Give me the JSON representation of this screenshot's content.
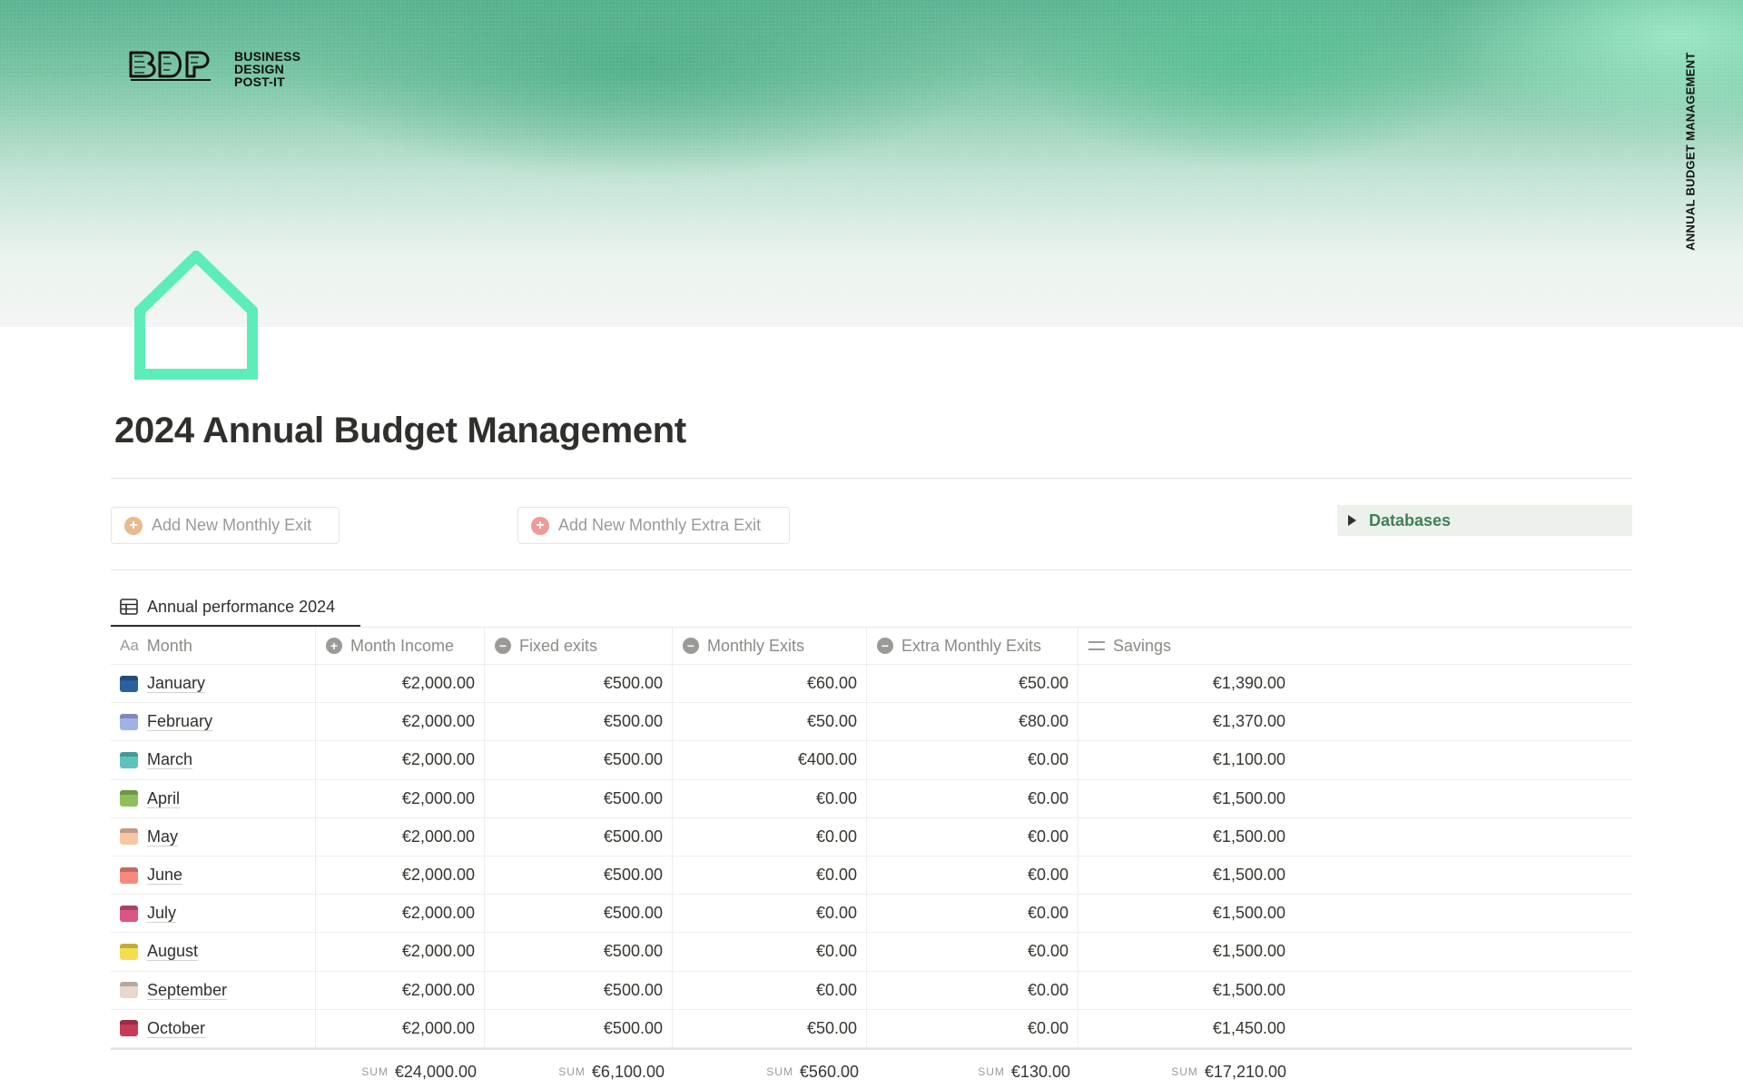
{
  "brand": {
    "logo_mark": "BDP",
    "logo_lines": [
      "BUSINESS",
      "DESIGN",
      "POST-IT"
    ],
    "vertical_label": "ANNUAL BUDGET MANAGEMENT"
  },
  "page": {
    "icon": "house-outline-icon",
    "title": "2024 Annual Budget Management"
  },
  "actions": {
    "add_monthly_exit": "Add New Monthly Exit",
    "add_monthly_extra_exit": "Add New Monthly Extra Exit",
    "databases_toggle": "Databases"
  },
  "colors": {
    "icon_accent": "#5cedb8",
    "plus_exit": "#e9b98f",
    "plus_extra_exit": "#ec9a9a",
    "databases_text": "#3f7f59"
  },
  "view": {
    "tab_label": "Annual performance 2024"
  },
  "table": {
    "headers": {
      "month": "Month",
      "month_prefix": "Aa",
      "income": "Month Income",
      "fixed": "Fixed exits",
      "monthly": "Monthly Exits",
      "extra": "Extra Monthly Exits",
      "savings": "Savings"
    },
    "rows": [
      {
        "month": "January",
        "color": "#2c5f9e",
        "income": "€2,000.00",
        "fixed": "€500.00",
        "monthly": "€60.00",
        "extra": "€50.00",
        "savings": "€1,390.00"
      },
      {
        "month": "February",
        "color": "#9eb2e6",
        "income": "€2,000.00",
        "fixed": "€500.00",
        "monthly": "€50.00",
        "extra": "€80.00",
        "savings": "€1,370.00"
      },
      {
        "month": "March",
        "color": "#5cc4bd",
        "income": "€2,000.00",
        "fixed": "€500.00",
        "monthly": "€400.00",
        "extra": "€0.00",
        "savings": "€1,100.00"
      },
      {
        "month": "April",
        "color": "#8fbf5a",
        "income": "€2,000.00",
        "fixed": "€500.00",
        "monthly": "€0.00",
        "extra": "€0.00",
        "savings": "€1,500.00"
      },
      {
        "month": "May",
        "color": "#f9c6a4",
        "income": "€2,000.00",
        "fixed": "€500.00",
        "monthly": "€0.00",
        "extra": "€0.00",
        "savings": "€1,500.00"
      },
      {
        "month": "June",
        "color": "#f78a7d",
        "income": "€2,000.00",
        "fixed": "€500.00",
        "monthly": "€0.00",
        "extra": "€0.00",
        "savings": "€1,500.00"
      },
      {
        "month": "July",
        "color": "#d9577f",
        "income": "€2,000.00",
        "fixed": "€500.00",
        "monthly": "€0.00",
        "extra": "€0.00",
        "savings": "€1,500.00"
      },
      {
        "month": "August",
        "color": "#f6dd4f",
        "income": "€2,000.00",
        "fixed": "€500.00",
        "monthly": "€0.00",
        "extra": "€0.00",
        "savings": "€1,500.00"
      },
      {
        "month": "September",
        "color": "#e8d8cb",
        "income": "€2,000.00",
        "fixed": "€500.00",
        "monthly": "€0.00",
        "extra": "€0.00",
        "savings": "€1,500.00"
      },
      {
        "month": "October",
        "color": "#c83a5a",
        "income": "€2,000.00",
        "fixed": "€500.00",
        "monthly": "€50.00",
        "extra": "€0.00",
        "savings": "€1,450.00"
      }
    ],
    "sums": {
      "label": "SUM",
      "income": "€24,000.00",
      "fixed": "€6,100.00",
      "monthly": "€560.00",
      "extra": "€130.00",
      "savings": "€17,210.00"
    }
  }
}
